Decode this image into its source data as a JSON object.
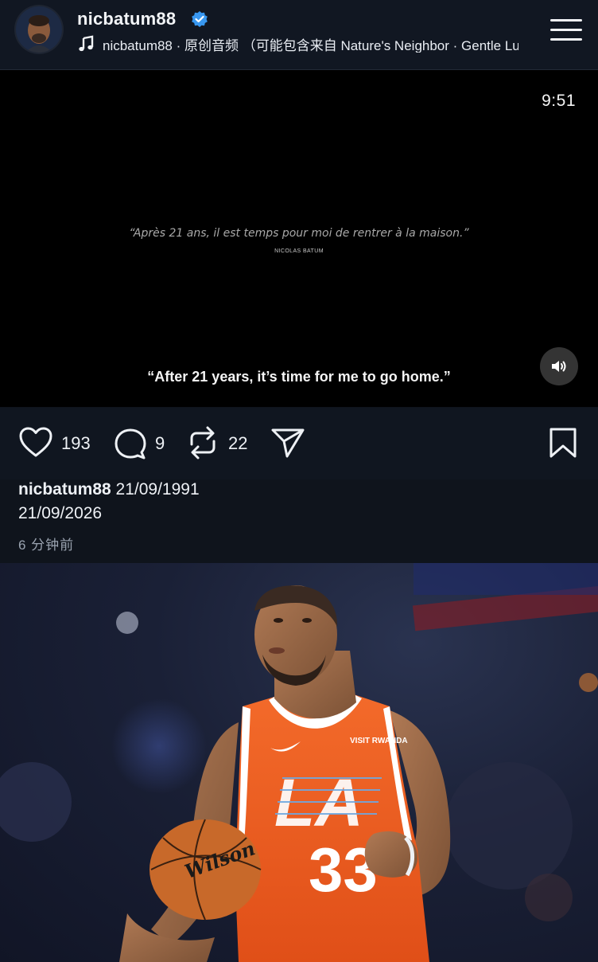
{
  "header": {
    "username": "nicbatum88",
    "verified_icon": "verified-badge-icon",
    "audio_icon": "music-note-icon",
    "audio_text": "nicbatum88 · 原创音频 （可能包含来自 Nature's Neighbor · Gentle Lu",
    "menu_icon": "hamburger-menu-icon"
  },
  "video": {
    "timer": "9:51",
    "quote_fr": "“Après 21 ans, il est temps pour moi de rentrer à la maison.”",
    "quote_author": "NICOLAS BATUM",
    "caption": "“After 21 years, it’s time for me to go home.”",
    "sound_icon": "speaker-icon"
  },
  "actions": {
    "likes": "193",
    "comments": "9",
    "reposts": "22"
  },
  "post": {
    "username": "nicbatum88",
    "text_line1": "21/09/1991",
    "text_line2": "21/09/2026",
    "time_ago": "6 分钟前"
  },
  "photo": {
    "jersey_text": "LA",
    "jersey_number": "33",
    "jersey_sponsor": "VISIT RWANDA",
    "ball_brand": "Wilson"
  },
  "colors": {
    "background": "#0f141c",
    "verified": "#3897f0",
    "jersey": "#f05a1e"
  }
}
